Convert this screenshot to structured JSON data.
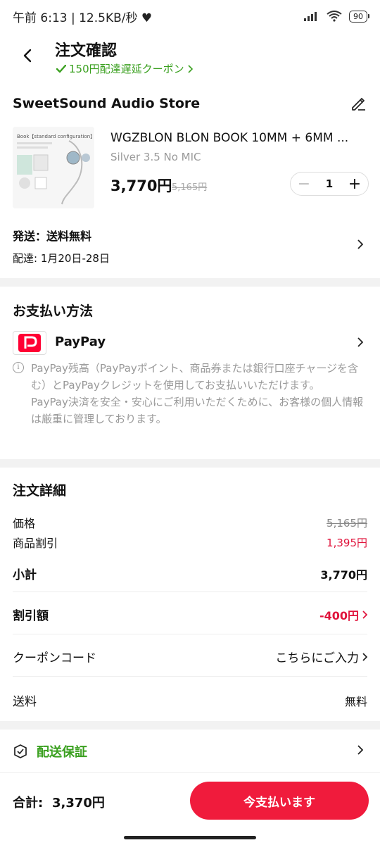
{
  "status_bar": {
    "left": "午前 6:13 | 12.5KB/秒 ♥",
    "battery": "90"
  },
  "header": {
    "title": "注文確認",
    "coupon": "150円配達遅延クーポン",
    "accent_color": "#3aa01f"
  },
  "store": {
    "name": "SweetSound Audio Store",
    "product": {
      "title": "WGZBLON BLON BOOK 10MM + 6MM ...",
      "variant": "Silver 3.5 No MIC",
      "price": "3,770円",
      "original_price": "5,165円",
      "quantity": "1",
      "image_caption": "Book【standard configuration】"
    },
    "shipping": {
      "label": "発送：送料無料",
      "delivery": "配達: 1月20日-28日"
    }
  },
  "payment": {
    "title": "お支払い方法",
    "method": "PayPay",
    "info_lines": [
      "PayPay残高（PayPayポイント、商品券または銀行口座チャージを含む）とPayPayクレジットを使用してお支払いいただけます。",
      "PayPay決済を安全・安心にご利用いただくために、お客様の個人情報は厳重に管理しております。"
    ]
  },
  "order_details": {
    "title": "注文詳細",
    "price_label": "価格",
    "price_value": "5,165円",
    "discount_label": "商品割引",
    "discount_value": "1,395円",
    "subtotal_label": "小計",
    "subtotal_value": "3,770円",
    "reduction_label": "割引額",
    "reduction_value": "-400円",
    "coupon_label": "クーポンコード",
    "coupon_value": "こちらにご入力",
    "shipping_label": "送料",
    "shipping_value": "無料"
  },
  "guarantee": {
    "label": "配送保証"
  },
  "footer": {
    "total_label": "合計:",
    "total_value": "3,370円",
    "pay_button": "今支払います",
    "button_color": "#f01b3c"
  }
}
